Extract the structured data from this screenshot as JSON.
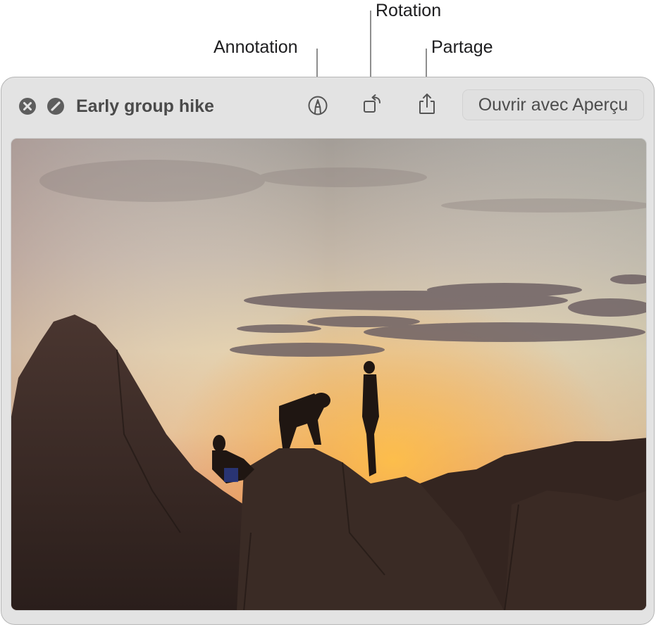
{
  "callouts": {
    "annotation": "Annotation",
    "rotation": "Rotation",
    "share": "Partage"
  },
  "window": {
    "title": "Early group hike",
    "open_with_button": "Ouvrir avec Aperçu",
    "icons": {
      "close": "close-icon",
      "fullscreen": "fullscreen-icon",
      "annotate": "markup-pen-icon",
      "rotate": "rotate-left-icon",
      "share": "share-icon"
    }
  },
  "photo": {
    "description": "Silhouettes of three hikers on red rock formations at sunset",
    "colors": {
      "sky_top": "#a8a39b",
      "sky_mid": "#e7cfa2",
      "horizon": "#f19535",
      "rock": "#3a2a24",
      "cloud": "#6d5f60"
    }
  }
}
